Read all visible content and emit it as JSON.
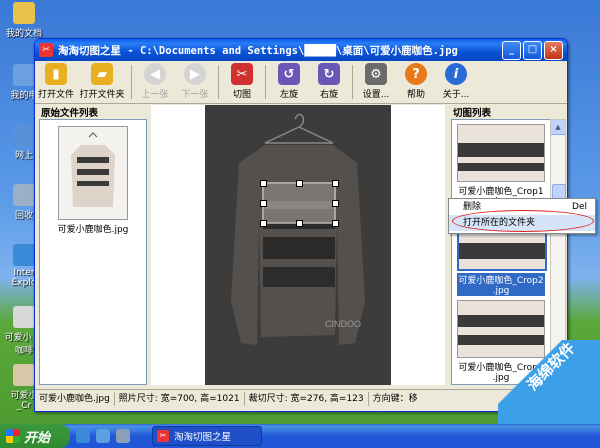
{
  "desktop": {
    "icons": [
      {
        "label": "我的文档",
        "color": "#e8c04a"
      },
      {
        "label": "我的电",
        "color": "#6aa0e0"
      },
      {
        "label": "网上",
        "color": "#5a90d8"
      },
      {
        "label": "回收",
        "color": "#9ab0c8"
      },
      {
        "label": "Inter Explo",
        "color": "#3a8ad8"
      },
      {
        "label": "可爱小 鹿咖啡",
        "color": "#d8d8d8"
      },
      {
        "label": "可爱小 _Cr",
        "color": "#d8c8a8"
      }
    ]
  },
  "window": {
    "app_icon_text": "✂",
    "title": "淘淘切图之星 - C:\\Documents and Settings\\█████\\桌面\\可爱小鹿咖色.jpg",
    "minimize": "_",
    "maximize": "□",
    "close": "×"
  },
  "toolbar": {
    "items": [
      {
        "label": "打开文件",
        "icon": "open-file-icon",
        "color": "#e8b020",
        "glyph": "▮",
        "enabled": true
      },
      {
        "label": "打开文件夹",
        "icon": "open-folder-icon",
        "color": "#e8b020",
        "glyph": "▰",
        "enabled": true
      },
      {
        "label": "上一张",
        "icon": "previous-icon",
        "color": "#c8c8c8",
        "glyph": "◀",
        "enabled": false
      },
      {
        "label": "下一张",
        "icon": "next-icon",
        "color": "#c8c8c8",
        "glyph": "▶",
        "enabled": false
      },
      {
        "label": "切图",
        "icon": "scissors-icon",
        "color": "#d03030",
        "glyph": "✂",
        "enabled": true
      },
      {
        "label": "左旋",
        "icon": "rotate-left-icon",
        "color": "#6a58b8",
        "glyph": "↺",
        "enabled": true
      },
      {
        "label": "右旋",
        "icon": "rotate-right-icon",
        "color": "#6a58b8",
        "glyph": "↻",
        "enabled": true
      },
      {
        "label": "设置...",
        "icon": "settings-icon",
        "color": "#6a6a6a",
        "glyph": "⚙",
        "enabled": true
      },
      {
        "label": "帮助",
        "icon": "help-icon",
        "color": "#e87818",
        "glyph": "?",
        "enabled": true
      },
      {
        "label": "关于...",
        "icon": "about-icon",
        "color": "#2a6ad8",
        "glyph": "i",
        "enabled": true
      }
    ]
  },
  "left_panel": {
    "title": "原始文件列表",
    "files": [
      {
        "name": "可爱小鹿咖色.jpg"
      }
    ]
  },
  "right_panel": {
    "title": "切图列表",
    "crops": [
      {
        "name": "可爱小鹿咖色_Crop1 .jpg",
        "selected": false
      },
      {
        "name": "可爱小鹿咖色_Crop2 .jpg",
        "selected": true
      },
      {
        "name": "可爱小鹿咖色_Crop3 .jpg",
        "selected": false
      }
    ]
  },
  "context_menu": {
    "items": [
      {
        "label": "删除",
        "shortcut": "Del"
      },
      {
        "label": "打开所在的文件夹",
        "shortcut": ""
      }
    ]
  },
  "statusbar": {
    "filename": "可爱小鹿咖色.jpg",
    "photo_size": "照片尺寸: 宽=700, 高=1021",
    "crop_size": "裁切尺寸: 宽=276, 高=123",
    "direction": "方向键：移"
  },
  "preview": {
    "watermark_text": "CINDOO"
  },
  "taskbar": {
    "start_label": "开始",
    "task_label": "淘淘切图之星"
  },
  "site_watermark": "海绵软件"
}
